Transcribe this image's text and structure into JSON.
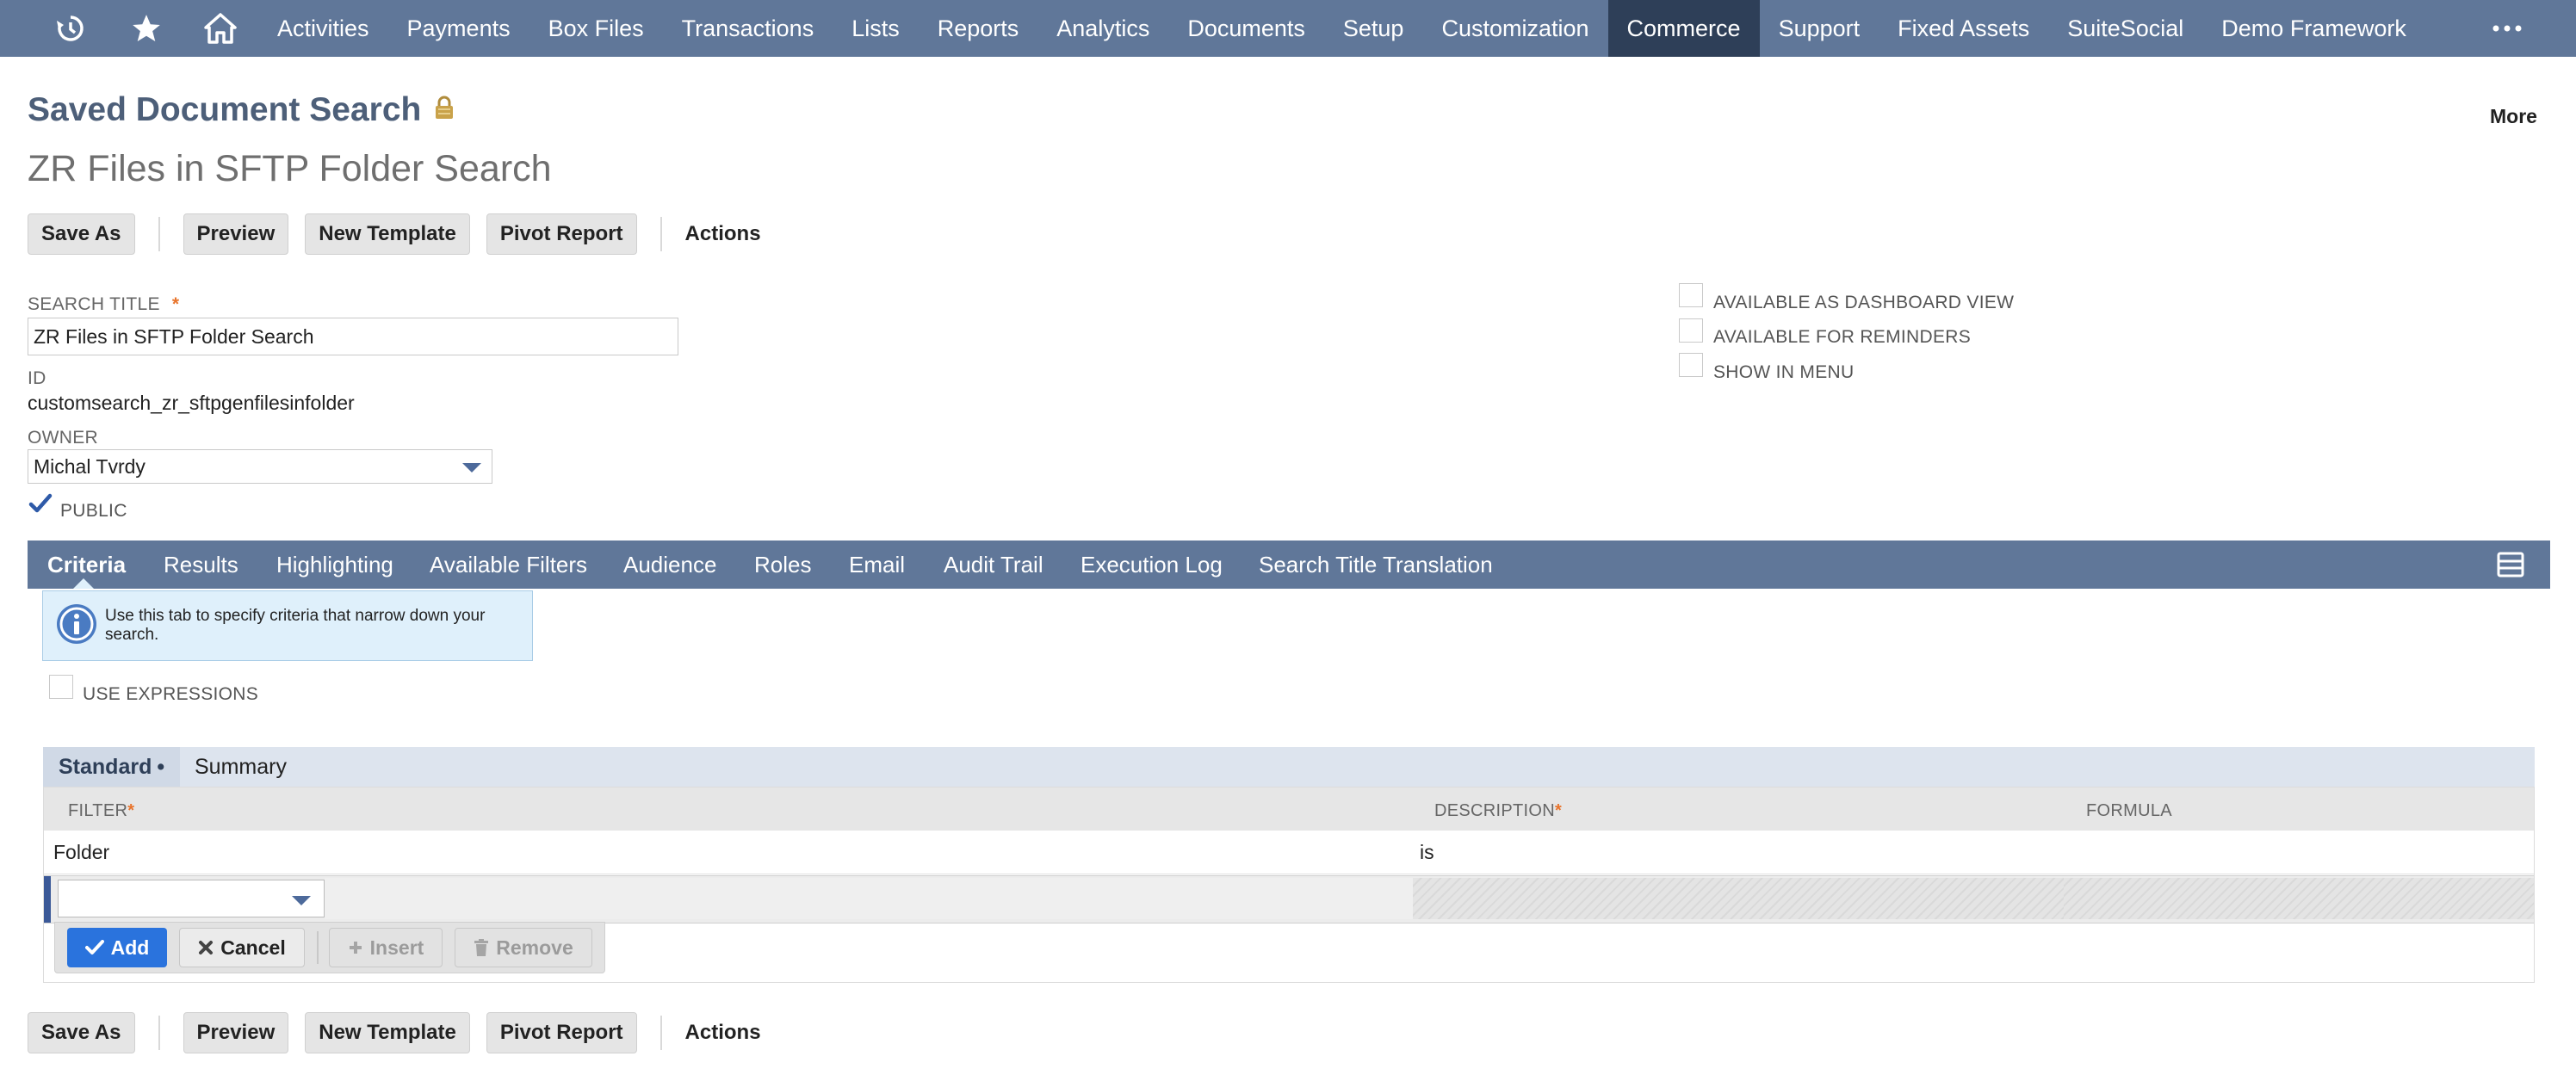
{
  "topnav": {
    "icons": [
      "recent-records-icon",
      "star-icon",
      "home-icon"
    ],
    "links": [
      "Activities",
      "Payments",
      "Box Files",
      "Transactions",
      "Lists",
      "Reports",
      "Analytics",
      "Documents",
      "Setup",
      "Customization",
      "Commerce",
      "Support",
      "Fixed Assets",
      "SuiteSocial",
      "Demo Framework"
    ],
    "active_link": "Commerce",
    "more_icon": "more-dots-icon"
  },
  "header": {
    "record_type": "Saved Document Search",
    "record_name": "ZR Files in SFTP Folder Search",
    "more_label": "More"
  },
  "buttons": {
    "save_as": "Save As",
    "preview": "Preview",
    "new_template": "New Template",
    "pivot_report": "Pivot Report",
    "actions": "Actions"
  },
  "form": {
    "search_title_label": "SEARCH TITLE",
    "required_marker": "*",
    "search_title_value": "ZR Files in SFTP Folder Search",
    "id_label": "ID",
    "id_value": "customsearch_zr_sftpgenfilesinfolder",
    "owner_label": "OWNER",
    "owner_value": "Michal Tvrdy",
    "public_label": "PUBLIC",
    "public_checked": true,
    "available_dashboard_label": "AVAILABLE AS DASHBOARD VIEW",
    "available_reminders_label": "AVAILABLE FOR REMINDERS",
    "show_in_menu_label": "SHOW IN MENU"
  },
  "tabs": {
    "items": [
      "Criteria",
      "Results",
      "Highlighting",
      "Available Filters",
      "Audience",
      "Roles",
      "Email",
      "Audit Trail",
      "Execution Log",
      "Search Title Translation"
    ],
    "active": "Criteria"
  },
  "criteria": {
    "info_text": "Use this tab to specify criteria that narrow down your search.",
    "use_expressions_label": "USE EXPRESSIONS",
    "subtabs": [
      "Standard",
      "Summary"
    ],
    "active_subtab": "Standard",
    "subtab_marker": "•",
    "columns": [
      "FILTER",
      "DESCRIPTION",
      "FORMULA"
    ],
    "rows": [
      {
        "filter": "Folder",
        "description": "is",
        "formula": ""
      }
    ],
    "edit_buttons": {
      "add": "Add",
      "cancel": "Cancel",
      "insert": "Insert",
      "remove": "Remove"
    }
  },
  "colors": {
    "nav_bg": "#607799",
    "nav_active": "#2e3f58",
    "title": "#4d5f79",
    "required": "#e8742c",
    "add_button": "#2a73dd",
    "info_bg": "#dff0fb"
  }
}
